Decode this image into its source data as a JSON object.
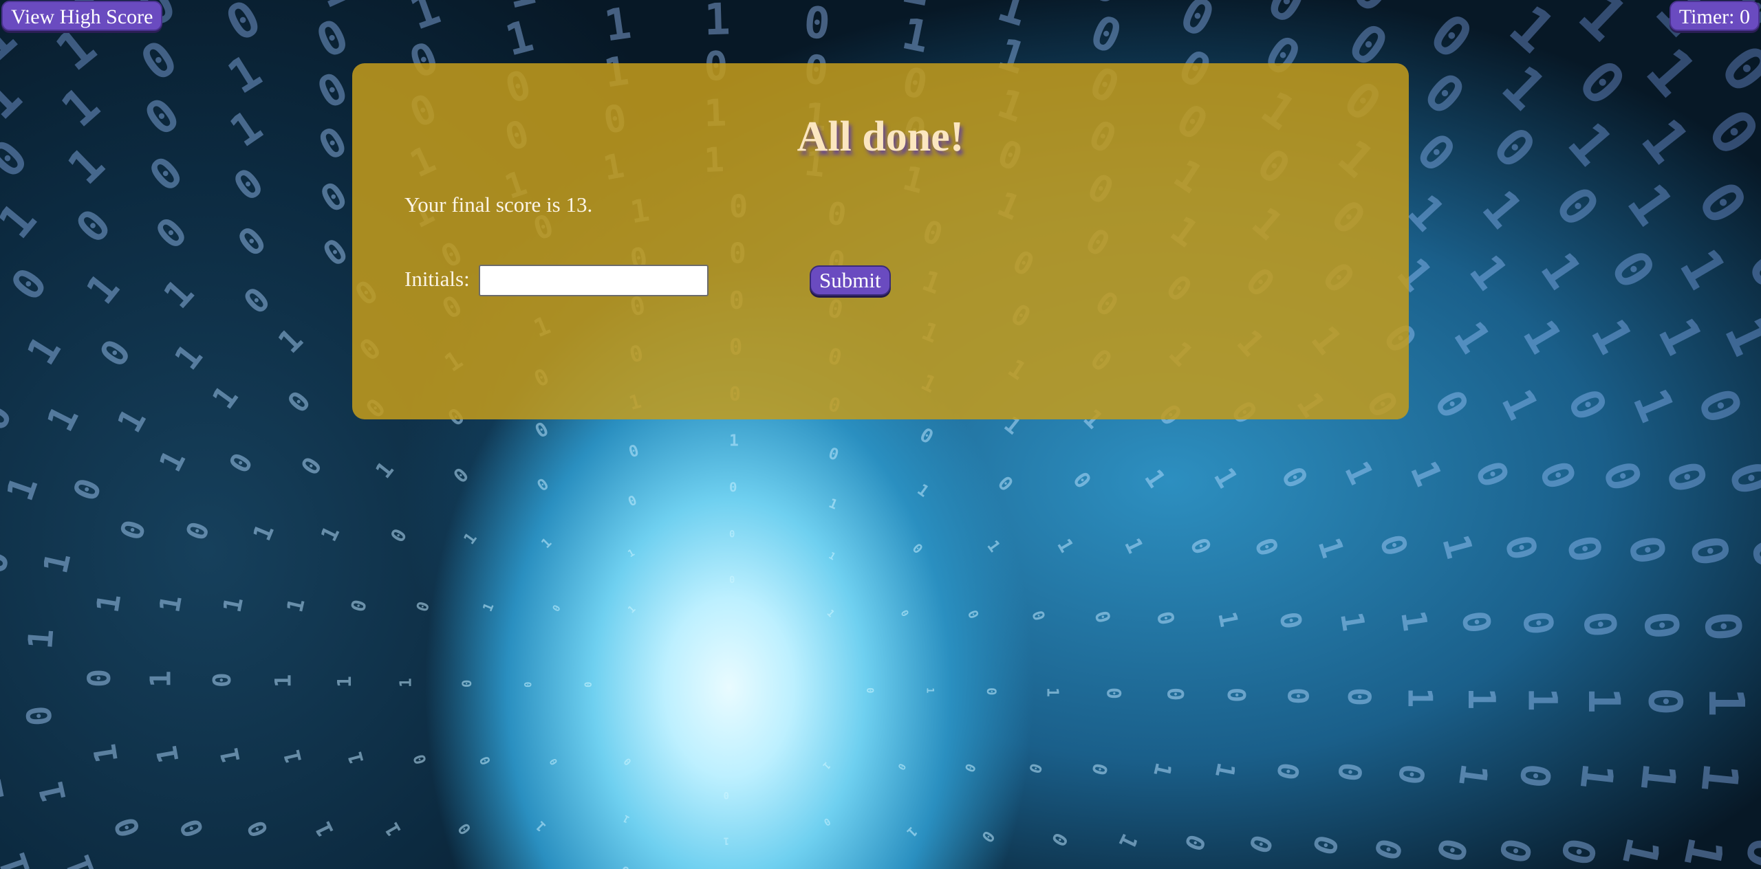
{
  "header": {
    "high_score_label": "View High Score",
    "timer_label": "Timer: 0"
  },
  "panel": {
    "title": "All done!",
    "score_text": "Your final score is 13.",
    "initials_label": "Initials:",
    "initials_value": "",
    "submit_label": "Submit"
  },
  "colors": {
    "panel": "#c49c1c",
    "button": "#6a4bc0",
    "title": "#fbe6c0"
  },
  "background": {
    "icon": "binary-tunnel-image"
  }
}
